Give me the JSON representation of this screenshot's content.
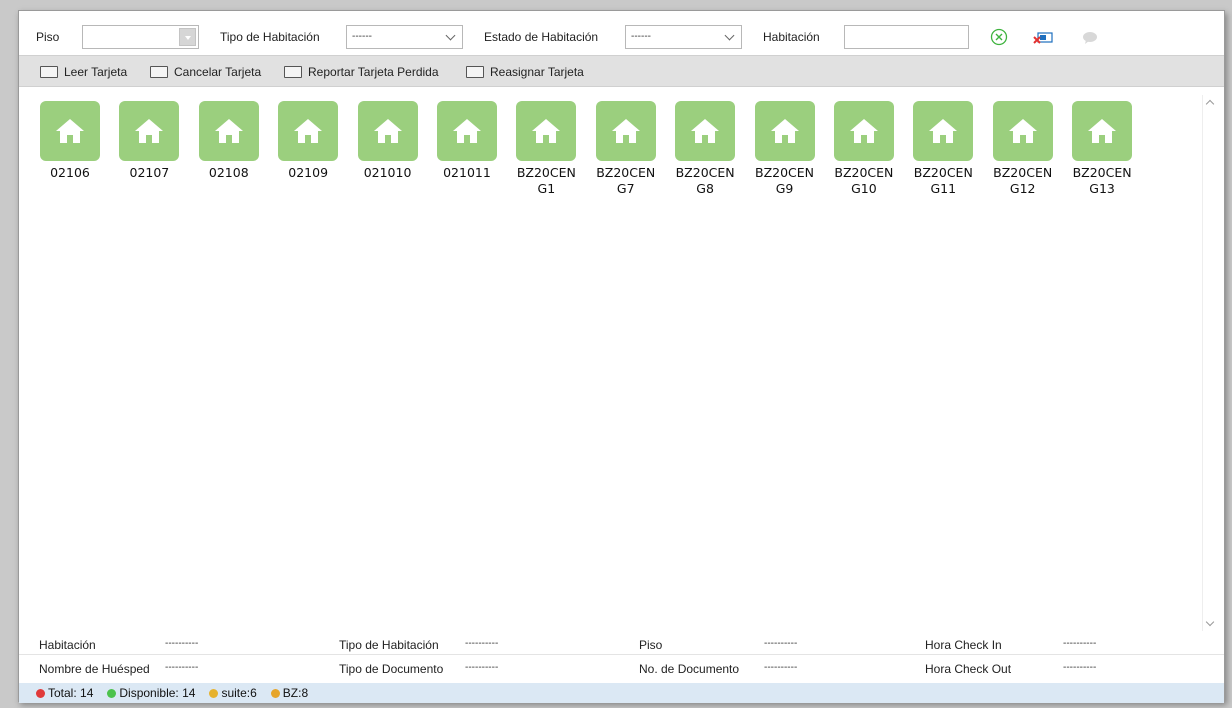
{
  "filters": {
    "floor_label": "Piso",
    "floor_value": "",
    "room_type_label": "Tipo de Habitación",
    "room_type_value": "------",
    "room_status_label": "Estado de Habitación",
    "room_status_value": "------",
    "room_label": "Habitación",
    "room_value": ""
  },
  "toolbar": {
    "read_card": "Leer Tarjeta",
    "cancel_card": "Cancelar Tarjeta",
    "report_lost": "Reportar Tarjeta Perdida",
    "reassign_card": "Reasignar Tarjeta"
  },
  "rooms": [
    "02106",
    "02107",
    "02108",
    "02109",
    "021010",
    "021011",
    "BZ20CEN G1",
    "BZ20CEN G7",
    "BZ20CEN G8",
    "BZ20CEN G9",
    "BZ20CEN G10",
    "BZ20CEN G11",
    "BZ20CEN G12",
    "BZ20CEN G13"
  ],
  "detail": {
    "room_label": "Habitación",
    "room_value": "----------",
    "room_type_label": "Tipo de Habitación",
    "room_type_value": "----------",
    "floor_label": "Piso",
    "floor_value": "----------",
    "checkin_label": "Hora Check In",
    "checkin_value": "----------",
    "guest_label": "Nombre de Huésped",
    "guest_value": "----------",
    "doc_type_label": "Tipo de Documento",
    "doc_type_value": "----------",
    "doc_no_label": "No. de Documento",
    "doc_no_value": "----------",
    "checkout_label": "Hora Check Out",
    "checkout_value": "----------"
  },
  "status": {
    "total": "Total: 14",
    "available": "Disponible: 14",
    "suite": "suite:6",
    "bz": "BZ:8"
  },
  "colors": {
    "room_tile": "#9bcf7e",
    "total_dot": "#e03a3a",
    "available_dot": "#4cc24c",
    "suite_dot": "#e6b22e",
    "bz_dot": "#e6a52a"
  }
}
